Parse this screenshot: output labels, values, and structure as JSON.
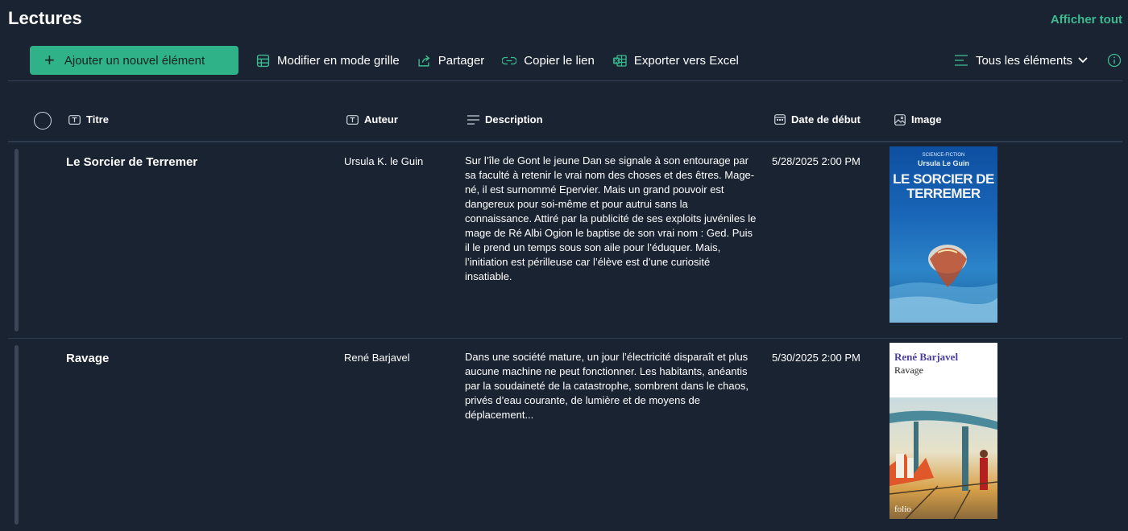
{
  "page": {
    "title": "Lectures",
    "show_all": "Afficher tout"
  },
  "toolbar": {
    "add_label": "Ajouter un nouvel élément",
    "grid_label": "Modifier en mode grille",
    "share_label": "Partager",
    "copy_link_label": "Copier le lien",
    "export_label": "Exporter vers Excel",
    "view_label": "Tous les éléments"
  },
  "columns": {
    "title": "Titre",
    "author": "Auteur",
    "description": "Description",
    "start_date": "Date de début",
    "image": "Image"
  },
  "rows": [
    {
      "title": "Le Sorcier de Terremer",
      "author": "Ursula K. le Guin",
      "description": "Sur l’île de Gont le jeune Dan se signale à son entourage par sa faculté à retenir le vrai nom des choses et des êtres. Mage-né, il est surnommé Epervier. Mais un grand pouvoir est dangereux pour soi-même et pour autrui sans la connaissance. Attiré par la publicité de ses exploits juvéniles le mage de Ré Albi Ogion le baptise de son vrai nom : Ged. Puis il le prend un temps sous son aile pour l’éduquer. Mais, l’initiation est périlleuse car l’élève est d’une curiosité insatiable.",
      "date": "5/28/2025 2:00 PM",
      "cover": {
        "series": "SCIENCE-FICTION",
        "author": "Ursula Le Guin",
        "title": "LE SORCIER DE TERREMER"
      }
    },
    {
      "title": "Ravage",
      "author": "René Barjavel",
      "description": "Dans une société mature, un jour l’électricité disparaît et plus aucune machine ne peut fonctionner. Les habitants, anéantis par la soudaineté de la catastrophe, sombrent dans le chaos, privés d’eau courante, de lumière et de moyens de déplacement...",
      "date": "5/30/2025 2:00 PM",
      "cover": {
        "author": "René Barjavel",
        "title": "Ravage",
        "publisher": "folio"
      }
    }
  ],
  "colors": {
    "background": "#1a2332",
    "accent": "#2fb287",
    "accent_text": "#3dbb8f"
  }
}
